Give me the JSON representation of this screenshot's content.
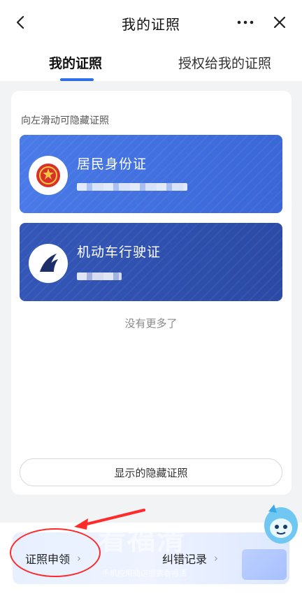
{
  "header": {
    "title": "我的证照",
    "back_icon": "chevron-left-icon",
    "more_icon": "more-horizontal-icon",
    "close_icon": "close-icon"
  },
  "tabs": [
    {
      "label": "我的证照",
      "active": true
    },
    {
      "label": "授权给我的证照",
      "active": false
    }
  ],
  "main": {
    "hint": "向左滑动可隐藏证照",
    "licenses": [
      {
        "name": "居民身份证",
        "icon": "national-emblem-icon",
        "color": "#4a7be8"
      },
      {
        "name": "机动车行驶证",
        "icon": "vehicle-license-logo-icon",
        "color": "#3457b8"
      }
    ],
    "no_more": "没有更多了",
    "show_hidden_label": "显示的隐藏证照"
  },
  "bottom": {
    "apply_label": "证照申领",
    "correction_label": "纠错记录"
  },
  "overlay": {
    "watermark": "看福清",
    "watermark_sub": "手机应用商店搜索看福清"
  },
  "colors": {
    "accent": "#2f6ee6",
    "annotation": "#ff2a2a"
  }
}
